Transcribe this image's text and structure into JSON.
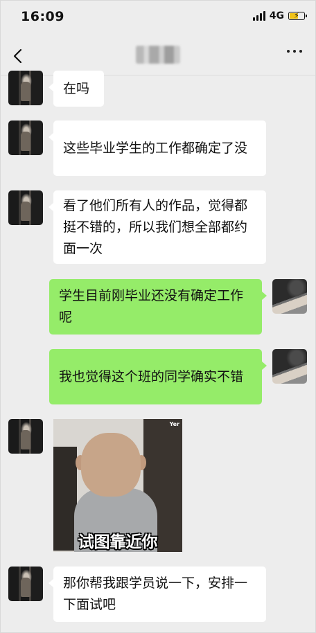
{
  "status_bar": {
    "time": "16:09",
    "network": "4G"
  },
  "nav": {
    "title": "",
    "more_icon": "more-dots-icon",
    "back_icon": "chevron-left-icon"
  },
  "messages": [
    {
      "side": "left",
      "text": "在吗"
    },
    {
      "side": "left",
      "text": "这些毕业学生的工作都确定了没"
    },
    {
      "side": "left",
      "text": "看了他们所有人的作品，觉得都挺不错的，所以我们想全部都约面一次"
    },
    {
      "side": "right",
      "text": "学生目前刚毕业还没有确定工作呢"
    },
    {
      "side": "right",
      "text": "我也觉得这个班的同学确实不错"
    },
    {
      "side": "left",
      "type": "sticker",
      "tag": "Yer",
      "caption": "试图靠近你"
    },
    {
      "side": "left",
      "text": "那你帮我跟学员说一下，安排一下面试吧"
    }
  ],
  "colors": {
    "background": "#ededed",
    "bubble_self": "#95ec69",
    "bubble_other": "#ffffff",
    "battery": "#f2c318"
  }
}
